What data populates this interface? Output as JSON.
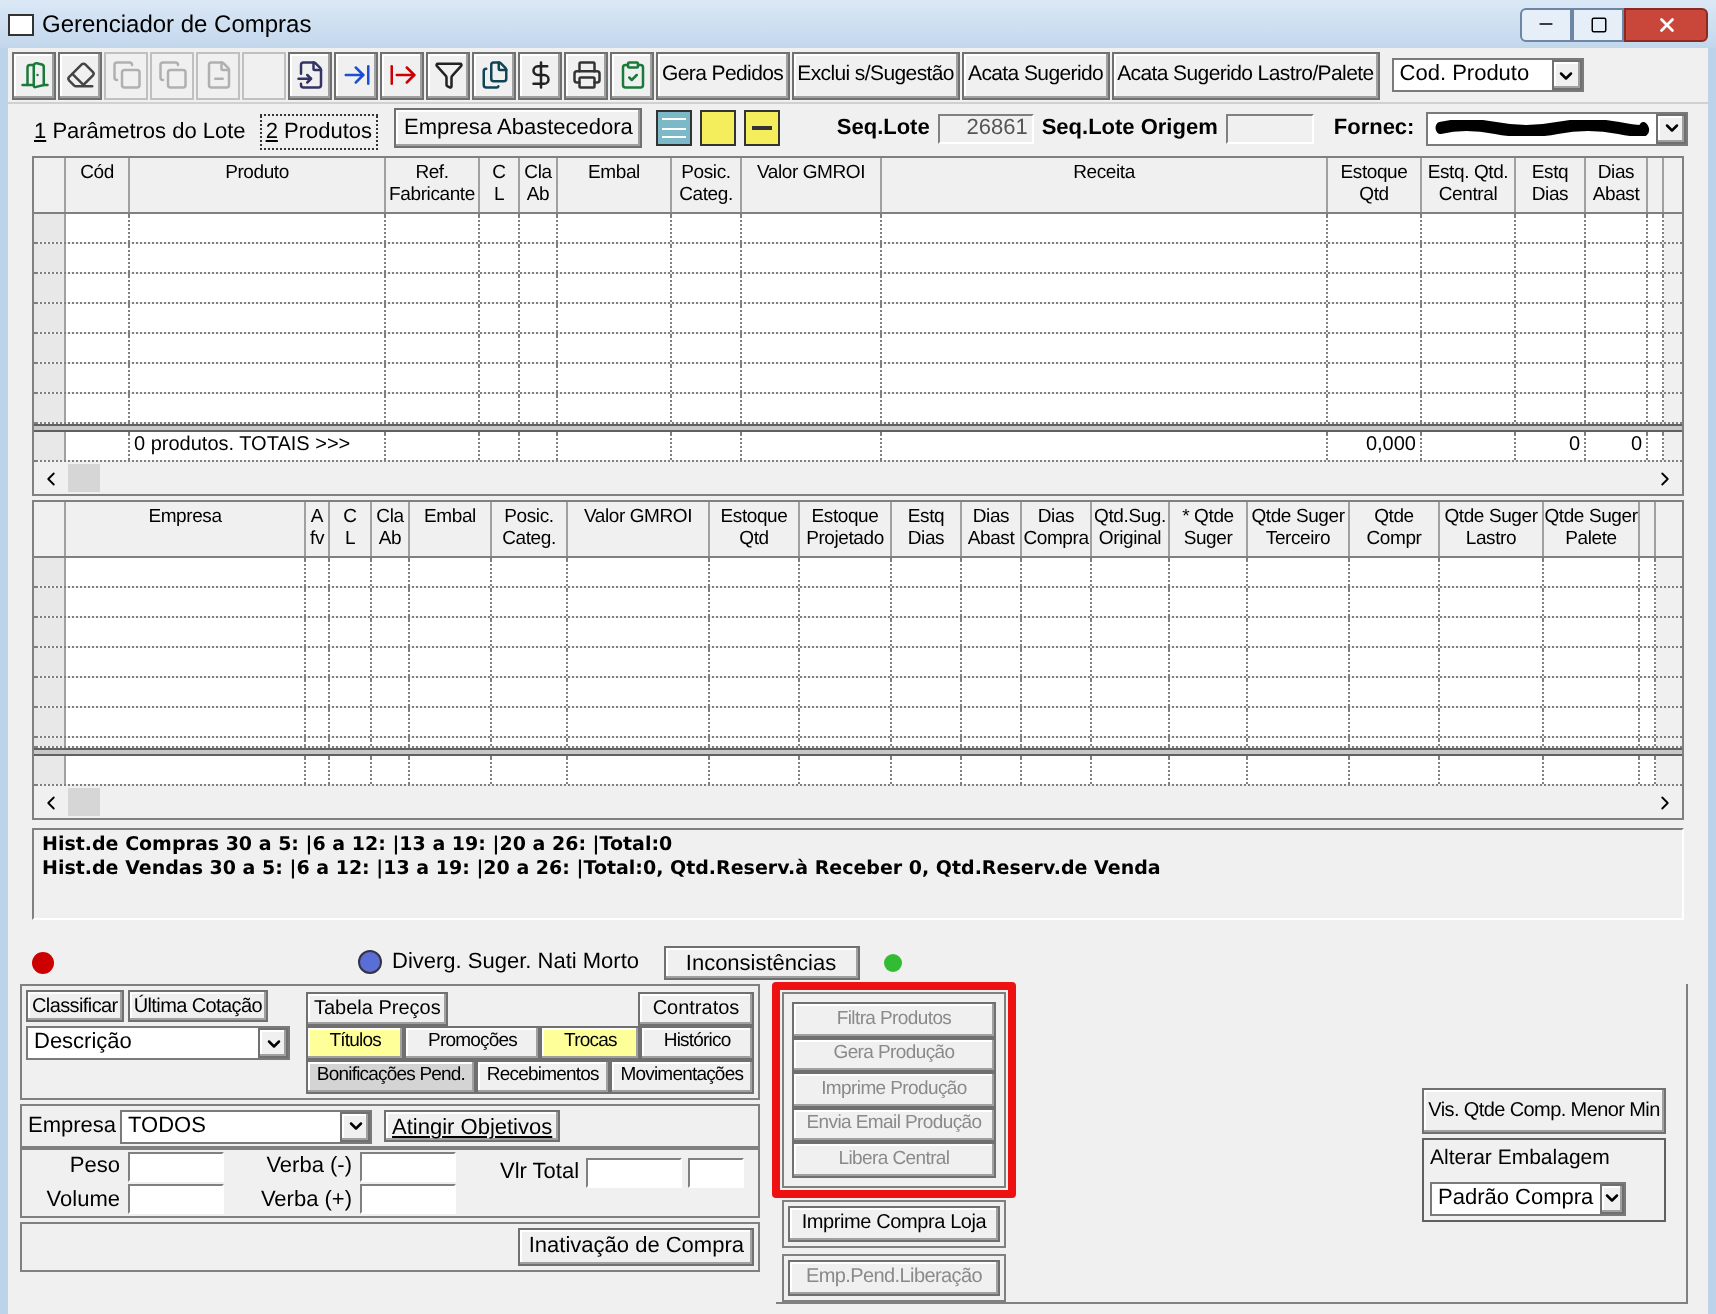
{
  "window": {
    "title": "Gerenciador de Compras"
  },
  "toolbar": {
    "icon_buttons": [
      {
        "disabled": false
      },
      {
        "disabled": false
      },
      {
        "disabled": true
      },
      {
        "disabled": true
      },
      {
        "disabled": true
      },
      {
        "disabled": true
      },
      {
        "disabled": false
      },
      {
        "disabled": false
      },
      {
        "disabled": false
      },
      {
        "disabled": false
      },
      {
        "disabled": false
      },
      {
        "disabled": false
      },
      {
        "disabled": false
      },
      {
        "disabled": false
      }
    ],
    "text_buttons": [
      "Gera Pedidos",
      "Exclui s/Sugestão",
      "Acata Sugerido",
      "Acata Sugerido Lastro/Palete"
    ],
    "order_combo": "Cod. Produto"
  },
  "tabs": [
    {
      "hotkey": "1",
      "label": "Parâmetros do Lote",
      "selected": false
    },
    {
      "hotkey": "2",
      "label": "Produtos",
      "selected": true
    }
  ],
  "empresa_button": "Empresa Abastecedora",
  "seq_lote": {
    "label": "Seq.Lote",
    "value": "26861"
  },
  "seq_lote_origem": {
    "label": "Seq.Lote Origem"
  },
  "fornec": {
    "label": "Fornec:"
  },
  "upper_grid": {
    "columns": [
      {
        "label": "Cód"
      },
      {
        "label": "Produto",
        "total": "0 produtos. TOTAIS >>>"
      },
      {
        "label": "Ref.\nFabricante"
      },
      {
        "label": "C\nL"
      },
      {
        "label": "Cla\nAb"
      },
      {
        "label": "Embal"
      },
      {
        "label": "Posic.\nCateg."
      },
      {
        "label": "Valor GMROI"
      },
      {
        "label": "Receita"
      },
      {
        "label": "Estoque\nQtd",
        "total": "0,000"
      },
      {
        "label": "Estq. Qtd.\nCentral"
      },
      {
        "label": "Estq\nDias",
        "total": "0"
      },
      {
        "label": "Dias\nAbast",
        "total": "0"
      }
    ]
  },
  "lower_grid": {
    "columns": [
      {
        "label": "Empresa"
      },
      {
        "label": "A\nfv"
      },
      {
        "label": "C\nL"
      },
      {
        "label": "Cla\nAb"
      },
      {
        "label": "Embal"
      },
      {
        "label": "Posic.\nCateg."
      },
      {
        "label": "Valor GMROI"
      },
      {
        "label": "Estoque\nQtd"
      },
      {
        "label": "Estoque\nProjetado"
      },
      {
        "label": "Estq\nDias"
      },
      {
        "label": "Dias\nAbast"
      },
      {
        "label": "Dias\nCompra"
      },
      {
        "label": "Qtd.Sug.\nOriginal"
      },
      {
        "label": "* Qtde\nSuger"
      },
      {
        "label": "Qtde Suger\nTerceiro"
      },
      {
        "label": "Qtde\nCompr"
      },
      {
        "label": "Qtde Suger\nLastro"
      },
      {
        "label": "Qtde Suger\nPalete"
      }
    ]
  },
  "history": [
    "Hist.de Compras 30 a 5: |6 a 12: |13 a 19: |20 a 26: |Total:0",
    "Hist.de Vendas 30 a 5: |6 a 12: |13 a 19: |20 a 26: |Total:0, Qtd.Reserv.à Receber 0, Qtd.Reserv.de Venda"
  ],
  "status": {
    "left_dot": {
      "color": "#cc0000"
    },
    "divergence": "Diverg. Suger. Nati Morto",
    "inconsistencies_button": "Inconsistências",
    "right_dot": {
      "color": "#33bb33"
    }
  },
  "sort": {
    "buttons": [
      "Classificar",
      "Última Cotação"
    ],
    "combo": "Descrição"
  },
  "tabela_button": "Tabela Preços",
  "contratos_button": "Contratos",
  "info_buttons": [
    [
      {
        "label": "Títulos",
        "color": "#ffff99"
      },
      {
        "label": "Promoções",
        "color": "#f0f0f0"
      },
      {
        "label": "Trocas",
        "color": "#ffff99"
      },
      {
        "label": "Histórico",
        "color": "#f0f0f0"
      }
    ],
    [
      {
        "label": "Bonificações Pend.",
        "color": "#d4d4d4"
      },
      {
        "label": "Recebimentos",
        "color": "#f0f0f0"
      },
      {
        "label": "Movimentações",
        "color": "#f0f0f0"
      }
    ]
  ],
  "empresa": {
    "label": "Empresa",
    "value": "TODOS",
    "button": "Atingir Objetivos"
  },
  "totals": {
    "peso": "Peso",
    "volume": "Volume",
    "verba_minus": "Verba (-)",
    "verba_plus": "Verba (+)",
    "vlr_total": "Vlr Total"
  },
  "inativacao_button": "Inativação de Compra",
  "production_buttons": [
    {
      "label": "Filtra Produtos",
      "disabled": true
    },
    {
      "label": "Gera Produção",
      "disabled": true
    },
    {
      "label": "Imprime Produção",
      "disabled": true
    },
    {
      "label": "Envia Email Produção",
      "disabled": true
    },
    {
      "label": "Libera Central",
      "disabled": true
    }
  ],
  "imprime_button": {
    "label": "Imprime Compra Loja",
    "disabled": false
  },
  "pendencia_button": {
    "label": "Emp.Pend.Liberação",
    "disabled": true
  },
  "vis_button": "Vis. Qtde Comp. Menor Min",
  "embalagem": {
    "title": "Alterar Embalagem",
    "value": "Padrão Compra"
  }
}
